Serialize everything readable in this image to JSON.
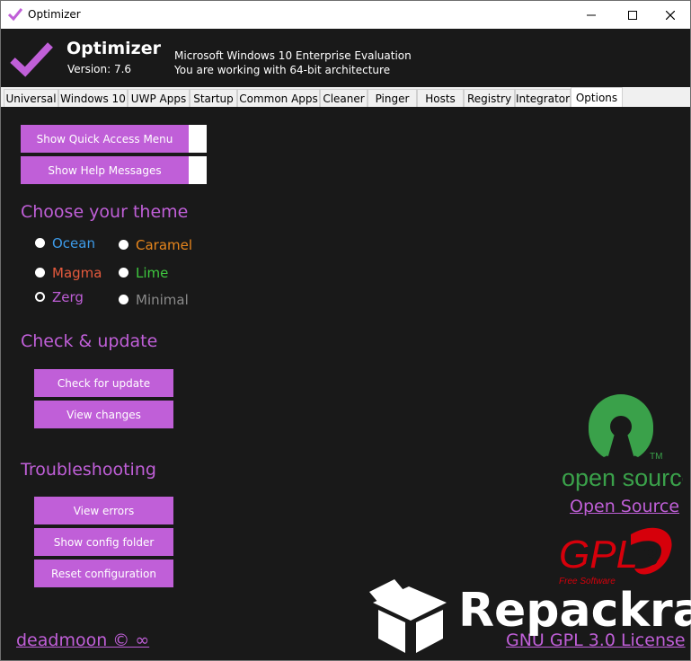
{
  "window": {
    "title": "Optimizer"
  },
  "header": {
    "app_name": "Optimizer",
    "version": "Version: 7.6",
    "os_info": "Microsoft Windows 10 Enterprise Evaluation",
    "arch_info": "You are working with 64-bit architecture"
  },
  "tabs": [
    {
      "label": "Universal"
    },
    {
      "label": "Windows 10"
    },
    {
      "label": "UWP Apps"
    },
    {
      "label": "Startup"
    },
    {
      "label": "Common Apps"
    },
    {
      "label": "Cleaner"
    },
    {
      "label": "Pinger"
    },
    {
      "label": "Hosts"
    },
    {
      "label": "Registry"
    },
    {
      "label": "Integrator"
    },
    {
      "label": "Options"
    }
  ],
  "options": {
    "quick_access_label": "Show Quick Access Menu",
    "help_messages_label": "Show Help Messages",
    "theme_title": "Choose your theme",
    "themes": [
      {
        "label": "Ocean",
        "color": "#3d9be9"
      },
      {
        "label": "Caramel",
        "color": "#e8861c"
      },
      {
        "label": "Magma",
        "color": "#e55a3d"
      },
      {
        "label": "Lime",
        "color": "#3fc83f"
      },
      {
        "label": "Zerg",
        "color": "#c05fd8"
      },
      {
        "label": "Minimal",
        "color": "#8a8a8a"
      }
    ],
    "selected_theme": "Zerg",
    "update_title": "Check & update",
    "check_update_label": "Check for update",
    "view_changes_label": "View changes",
    "troubleshooting_title": "Troubleshooting",
    "view_errors_label": "View errors",
    "config_folder_label": "Show config folder",
    "reset_config_label": "Reset configuration",
    "author_link": "deadmoon © ∞",
    "open_source_logo_text": "open source",
    "open_source_link": "Open Source",
    "gpl_logo_text": "GPL",
    "gpl_logo_subtext": "Free Software",
    "license_link": "GNU GPL 3.0 License",
    "watermark_text": "Repackra"
  },
  "colors": {
    "accent": "#c05fd8",
    "background": "#191919",
    "open_source_green": "#3aa14a",
    "gpl_red": "#d6000b"
  }
}
